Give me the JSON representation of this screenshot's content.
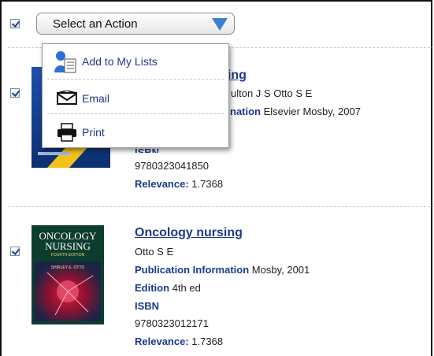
{
  "action_bar": {
    "select_label": "Select an Action"
  },
  "menu": {
    "items": [
      {
        "label": "Add to My Lists",
        "icon": "add-to-list-icon"
      },
      {
        "label": "Email",
        "icon": "email-envelope-icon"
      },
      {
        "label": "Print",
        "icon": "printer-icon"
      }
    ]
  },
  "results": [
    {
      "title": "Nursing",
      "title_visible": "sing",
      "author_visible": "ulton J S Otto S E",
      "pub_label_visible": "nation",
      "publication": "Elsevier Mosby, 2007",
      "isbn_label": "ISBN",
      "isbn": "9780323041850",
      "relevance_label": "Relevance:",
      "relevance": "1.7368"
    },
    {
      "title": "Oncology nursing",
      "author": "Otto S E",
      "pub_label": "Publication Information",
      "publication": "Mosby, 2001",
      "edition_label": "Edition",
      "edition": "4th ed",
      "isbn_label": "ISBN",
      "isbn": "9780323012171",
      "relevance_label": "Relevance:",
      "relevance": "1.7368",
      "cover_title_line1": "ONCOLOGY",
      "cover_title_line2": "NURSING",
      "cover_edition": "FOURTH EDITION",
      "cover_author": "SHIRLEY E. OTTO"
    }
  ],
  "colors": {
    "link": "#1d3a8a",
    "dropdown_arrow": "#3f7fd0"
  }
}
